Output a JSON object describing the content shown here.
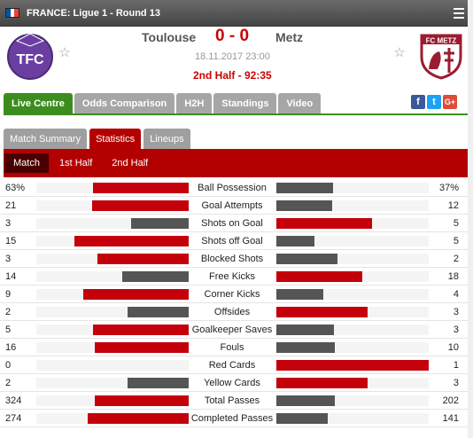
{
  "league": {
    "title": "FRANCE: Ligue 1 - Round 13"
  },
  "match": {
    "home_team": "Toulouse",
    "away_team": "Metz",
    "score": "0 - 0",
    "datetime": "18.11.2017 23:00",
    "status": "2nd Half - 92:35"
  },
  "main_tabs": [
    {
      "label": "Live Centre",
      "active": true
    },
    {
      "label": "Odds Comparison",
      "active": false
    },
    {
      "label": "H2H",
      "active": false
    },
    {
      "label": "Standings",
      "active": false
    },
    {
      "label": "Video",
      "active": false
    }
  ],
  "share": [
    {
      "icon": "facebook-icon",
      "glyph": "f",
      "color": "#3b5998"
    },
    {
      "icon": "twitter-icon",
      "glyph": "t",
      "color": "#1da1f2"
    },
    {
      "icon": "googleplus-icon",
      "glyph": "G+",
      "color": "#dd4b39"
    }
  ],
  "sub_tabs": [
    {
      "label": "Match Summary",
      "active": false
    },
    {
      "label": "Statistics",
      "active": true
    },
    {
      "label": "Lineups",
      "active": false
    }
  ],
  "period_tabs": [
    {
      "label": "Match",
      "active": true
    },
    {
      "label": "1st Half",
      "active": false
    },
    {
      "label": "2nd Half",
      "active": false
    }
  ],
  "colors": {
    "winner": "#c4000a",
    "loser": "#555555"
  },
  "stats": [
    {
      "label": "Ball Possession",
      "home": "63%",
      "away": "37%",
      "home_frac": 0.63,
      "away_frac": 0.37
    },
    {
      "label": "Goal Attempts",
      "home": "21",
      "away": "12",
      "home_frac": 0.636,
      "away_frac": 0.364
    },
    {
      "label": "Shots on Goal",
      "home": "3",
      "away": "5",
      "home_frac": 0.375,
      "away_frac": 0.625
    },
    {
      "label": "Shots off Goal",
      "home": "15",
      "away": "5",
      "home_frac": 0.75,
      "away_frac": 0.25
    },
    {
      "label": "Blocked Shots",
      "home": "3",
      "away": "2",
      "home_frac": 0.6,
      "away_frac": 0.4
    },
    {
      "label": "Free Kicks",
      "home": "14",
      "away": "18",
      "home_frac": 0.4375,
      "away_frac": 0.5625
    },
    {
      "label": "Corner Kicks",
      "home": "9",
      "away": "4",
      "home_frac": 0.692,
      "away_frac": 0.308
    },
    {
      "label": "Offsides",
      "home": "2",
      "away": "3",
      "home_frac": 0.4,
      "away_frac": 0.6
    },
    {
      "label": "Goalkeeper Saves",
      "home": "5",
      "away": "3",
      "home_frac": 0.625,
      "away_frac": 0.375
    },
    {
      "label": "Fouls",
      "home": "16",
      "away": "10",
      "home_frac": 0.615,
      "away_frac": 0.385
    },
    {
      "label": "Red Cards",
      "home": "0",
      "away": "1",
      "home_frac": 0.0,
      "away_frac": 1.0
    },
    {
      "label": "Yellow Cards",
      "home": "2",
      "away": "3",
      "home_frac": 0.4,
      "away_frac": 0.6
    },
    {
      "label": "Total Passes",
      "home": "324",
      "away": "202",
      "home_frac": 0.616,
      "away_frac": 0.384
    },
    {
      "label": "Completed Passes",
      "home": "274",
      "away": "141",
      "home_frac": 0.66,
      "away_frac": 0.34
    }
  ]
}
